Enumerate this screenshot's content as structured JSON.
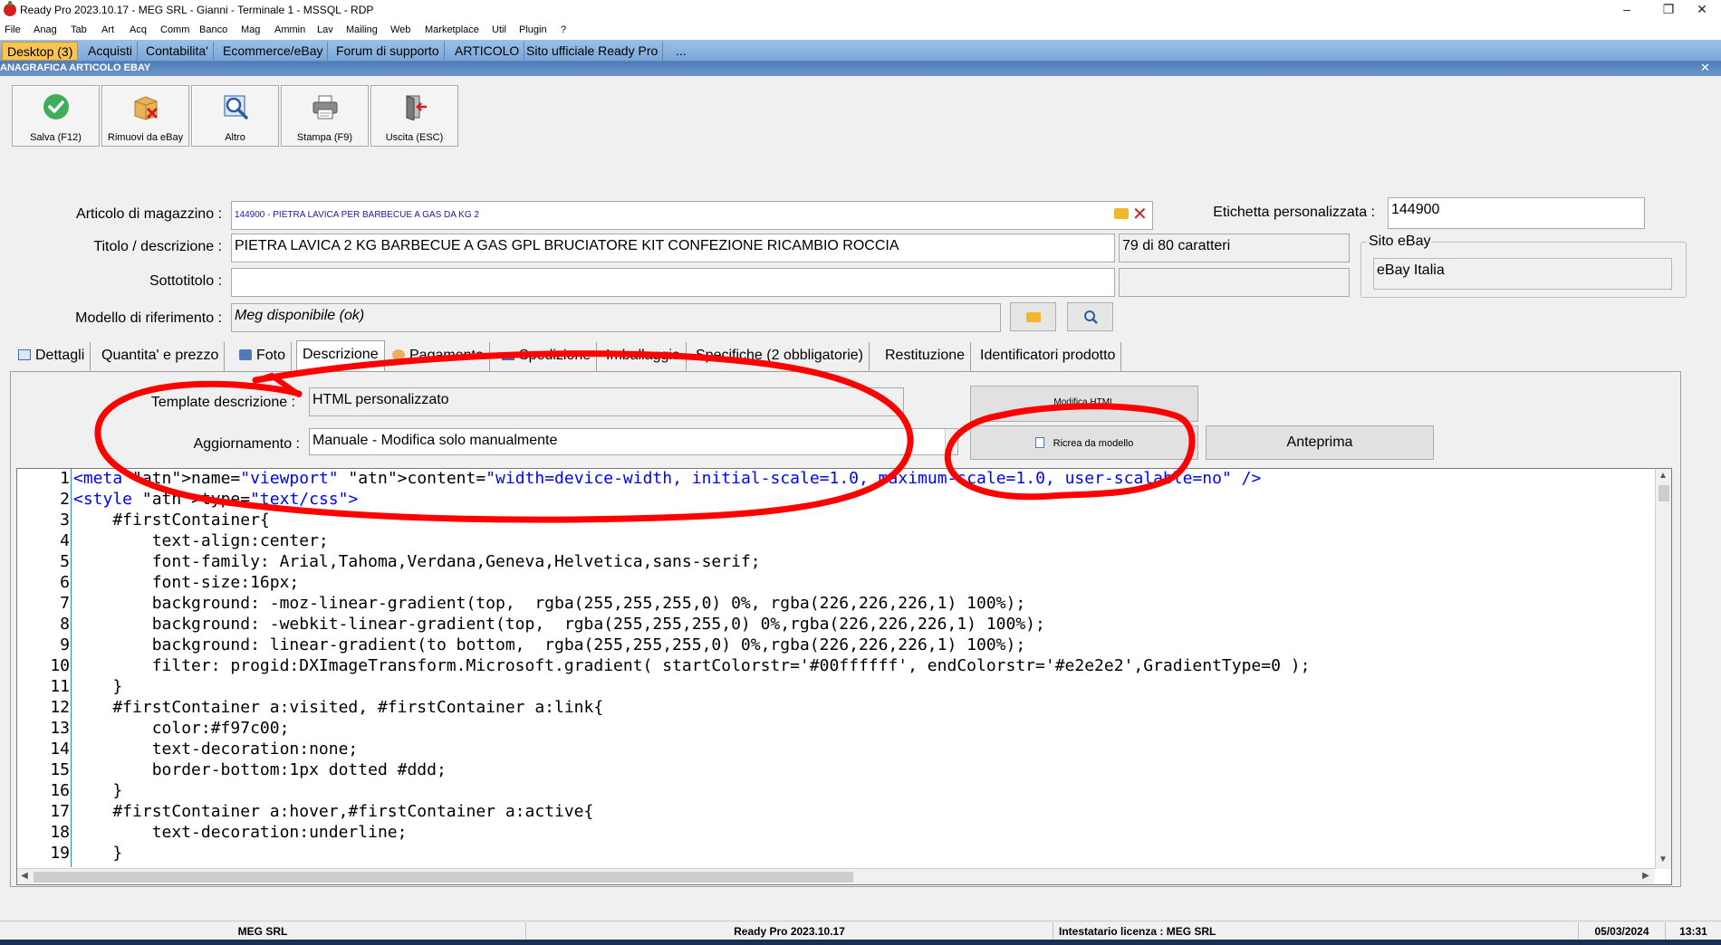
{
  "window": {
    "title": "Ready Pro 2023.10.17 - MEG SRL - Gianni - Terminale 1 - MSSQL - RDP",
    "minimize_glyph": "‒",
    "restore_glyph": "❐",
    "close_glyph": "✕"
  },
  "menu": [
    "File",
    "Anag",
    "Tab",
    "Art",
    "Acq",
    "Comm",
    "Banco",
    "Mag",
    "Ammin",
    "Lav",
    "Mailing",
    "Web",
    "Marketplace",
    "Util",
    "Plugin",
    "?"
  ],
  "doc_tabs": [
    "Desktop (3)",
    "Acquisti",
    "Contabilita'",
    "Ecommerce/eBay",
    "Forum di supporto",
    "ARTICOLO",
    "Sito ufficiale Ready Pro",
    "..."
  ],
  "form": {
    "header": "ANAGRAFICA ARTICOLO EBAY",
    "close_glyph": "✕"
  },
  "toolbar": {
    "save": {
      "label": "Salva (F12)",
      "icon": "check-icon"
    },
    "remove": {
      "label": "Rimuovi da eBay",
      "icon": "box-remove-icon"
    },
    "other": {
      "label": "Altro",
      "icon": "magnifier-icon"
    },
    "print": {
      "label": "Stampa (F9)",
      "icon": "printer-icon"
    },
    "exit": {
      "label": "Uscita (ESC)",
      "icon": "exit-door-icon"
    }
  },
  "fields": {
    "articolo_label": "Articolo di magazzino :",
    "articolo_value": "144900 - PIETRA LAVICA PER BARBECUE A GAS DA KG 2",
    "etichetta_label": "Etichetta personalizzata :",
    "etichetta_value": "144900",
    "titolo_label": "Titolo / descrizione :",
    "titolo_value": "PIETRA LAVICA 2 KG BARBECUE A GAS GPL BRUCIATORE KIT CONFEZIONE RICAMBIO ROCCIA",
    "char_count": "79 di 80 caratteri",
    "sito_ebay_label": "Sito eBay",
    "sito_ebay_value": "eBay Italia",
    "sottotitolo_label": "Sottotitolo :",
    "sottotitolo_value": "",
    "modello_label": "Modello di riferimento :",
    "modello_value": "Meg disponibile (ok)"
  },
  "tabs": [
    {
      "label": "Dettagli",
      "icon": "details-icon"
    },
    {
      "label": "Quantita' e prezzo",
      "icon": ""
    },
    {
      "label": "Foto",
      "icon": "photo-icon"
    },
    {
      "label": "Descrizione",
      "icon": ""
    },
    {
      "label": "Pagamento",
      "icon": "payment-icon"
    },
    {
      "label": "Spedizione",
      "icon": "shipping-icon"
    },
    {
      "label": "Imballaggio",
      "icon": ""
    },
    {
      "label": "Specifiche (2 obbligatorie)",
      "icon": ""
    },
    {
      "label": "Restituzione",
      "icon": ""
    },
    {
      "label": "Identificatori prodotto",
      "icon": ""
    }
  ],
  "active_tab": "Descrizione",
  "descrizione": {
    "template_label": "Template descrizione :",
    "template_value": "HTML personalizzato",
    "aggiornamento_label": "Aggiornamento :",
    "aggiornamento_value": "Manuale - Modifica solo manualmente",
    "modifica_html_label": "Modifica HTML",
    "ricrea_label": "Ricrea da modello",
    "anteprima_label": "Anteprima"
  },
  "code_lines": [
    {
      "n": "1",
      "t": "<meta name=\"viewport\" content=\"width=device-width, initial-scale=1.0, maximum-scale=1.0, user-scalable=no\" />"
    },
    {
      "n": "2",
      "t": "<style type=\"text/css\">"
    },
    {
      "n": "3",
      "t": "    #firstContainer{"
    },
    {
      "n": "4",
      "t": "        text-align:center;"
    },
    {
      "n": "5",
      "t": "        font-family: Arial,Tahoma,Verdana,Geneva,Helvetica,sans-serif;"
    },
    {
      "n": "6",
      "t": "        font-size:16px;"
    },
    {
      "n": "7",
      "t": "        background: -moz-linear-gradient(top,  rgba(255,255,255,0) 0%, rgba(226,226,226,1) 100%);"
    },
    {
      "n": "8",
      "t": "        background: -webkit-linear-gradient(top,  rgba(255,255,255,0) 0%,rgba(226,226,226,1) 100%);"
    },
    {
      "n": "9",
      "t": "        background: linear-gradient(to bottom,  rgba(255,255,255,0) 0%,rgba(226,226,226,1) 100%);"
    },
    {
      "n": "10",
      "t": "        filter: progid:DXImageTransform.Microsoft.gradient( startColorstr='#00ffffff', endColorstr='#e2e2e2',GradientType=0 );"
    },
    {
      "n": "11",
      "t": "    }"
    },
    {
      "n": "12",
      "t": "    #firstContainer a:visited, #firstContainer a:link{"
    },
    {
      "n": "13",
      "t": "        color:#f97c00;"
    },
    {
      "n": "14",
      "t": "        text-decoration:none;"
    },
    {
      "n": "15",
      "t": "        border-bottom:1px dotted #ddd;"
    },
    {
      "n": "16",
      "t": "    }"
    },
    {
      "n": "17",
      "t": "    #firstContainer a:hover,#firstContainer a:active{"
    },
    {
      "n": "18",
      "t": "        text-decoration:underline;"
    },
    {
      "n": "19",
      "t": "    }"
    }
  ],
  "status": {
    "company": "MEG SRL",
    "version": "Ready Pro 2023.10.17",
    "licensee": "Intestatario licenza : MEG  SRL",
    "date": "05/03/2024",
    "time": "13:31"
  },
  "colors": {
    "annotation_red": "#ff0000",
    "doc_tab_active": "#f8c458",
    "form_header": "#4f7cb6",
    "code_tag": "#0000ff",
    "code_attr_name": "#ff0000"
  }
}
